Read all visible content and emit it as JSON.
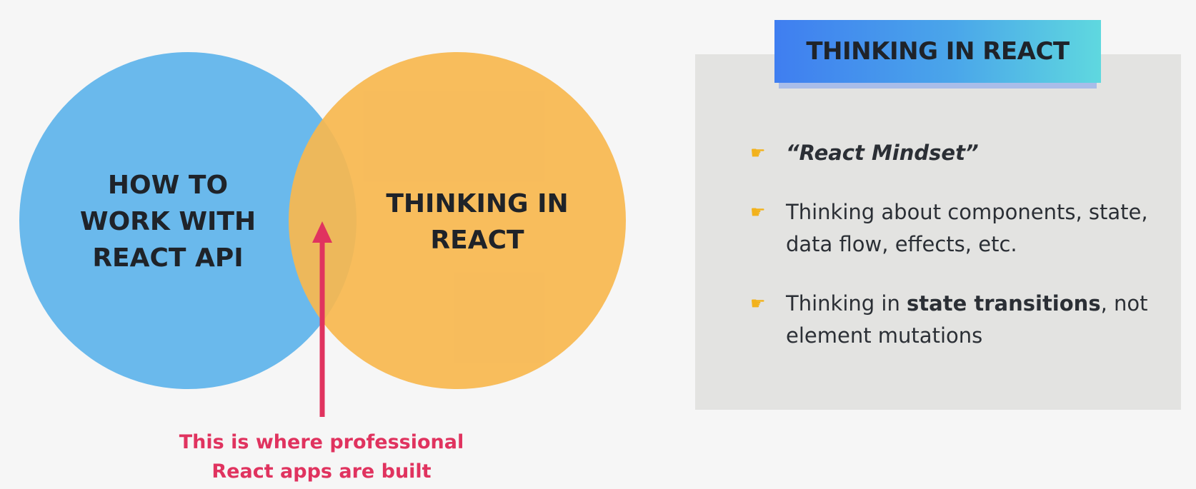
{
  "venn": {
    "left_label": "HOW TO\nWORK WITH\nREACT API",
    "right_label": "THINKING IN\nREACT",
    "caption": "This is where professional\nReact apps are built",
    "colors": {
      "left_circle": "#6ab9ec",
      "right_circle": "#f7b850",
      "arrow": "#e0335f"
    }
  },
  "panel": {
    "title": "THINKING IN REACT",
    "bullet_icon": "pointing-hand-icon",
    "bullets": [
      {
        "text": "“React Mindset”"
      },
      {
        "text": "Thinking about components, state, data flow, effects, etc."
      },
      {
        "before": "Thinking in ",
        "bold": "state transitions",
        "after": ", not element mutations"
      }
    ]
  }
}
